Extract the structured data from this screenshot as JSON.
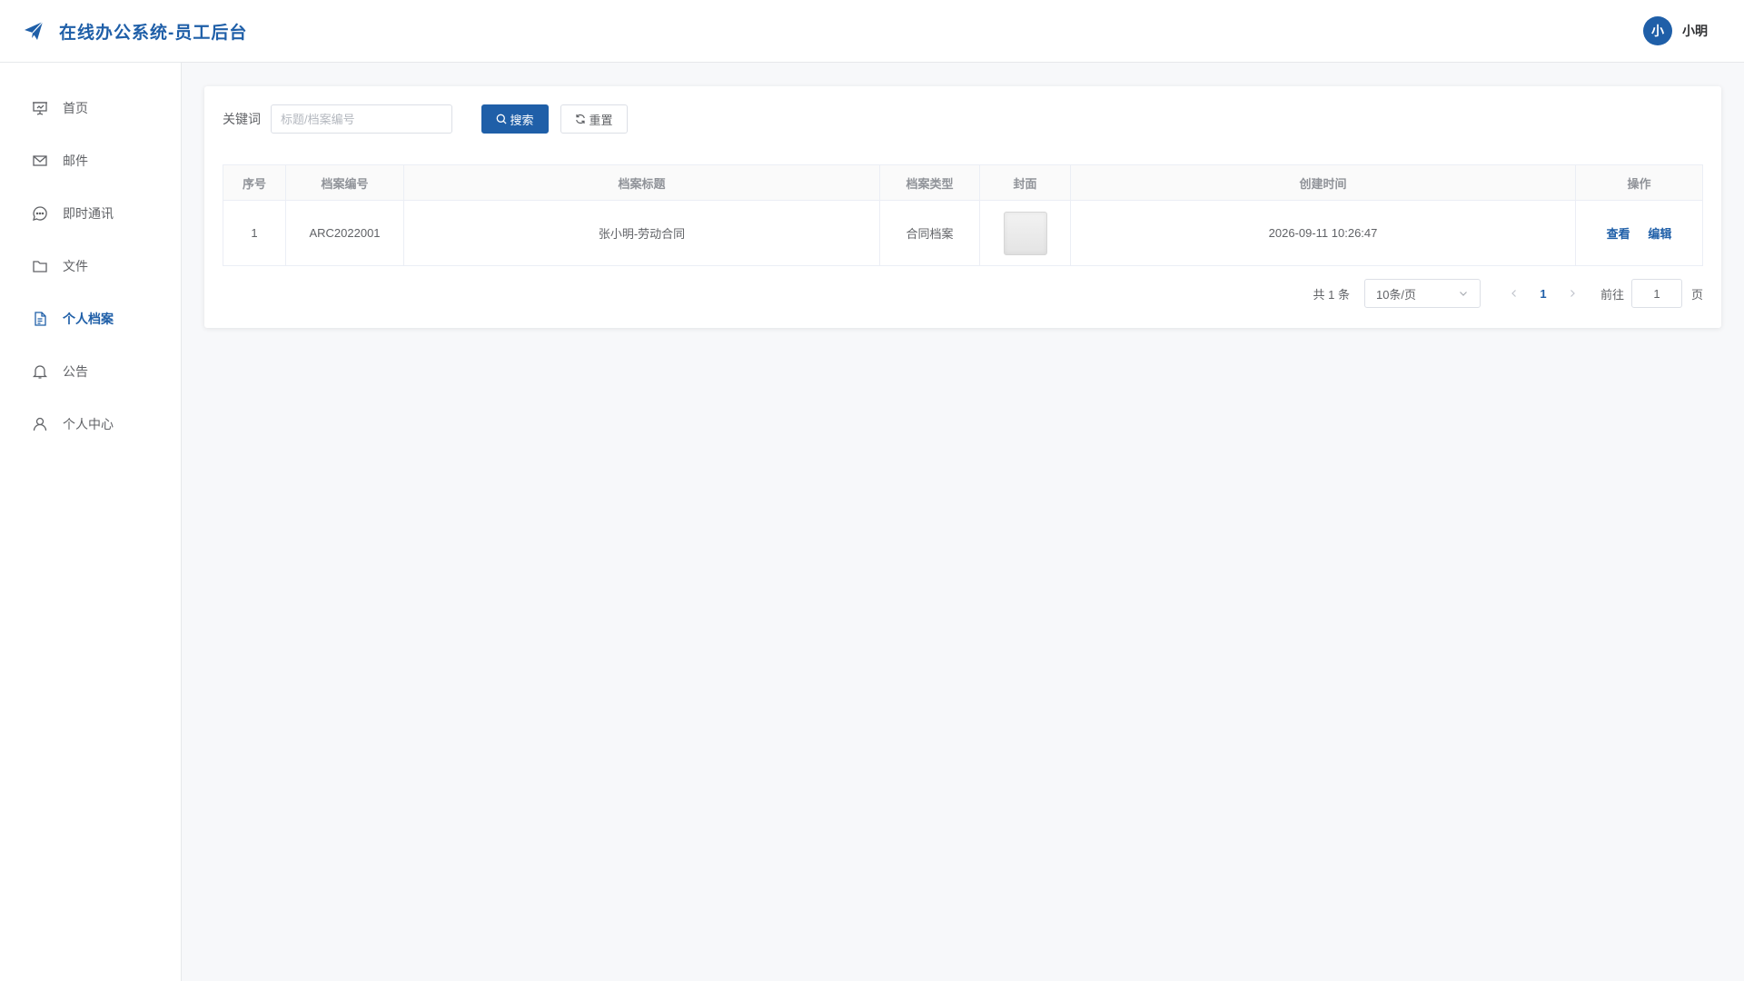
{
  "app": {
    "title": "在线办公系统-员工后台"
  },
  "user": {
    "avatar_text": "小",
    "name": "小明"
  },
  "sidebar": {
    "items": [
      {
        "label": "首页",
        "icon": "presentation-icon"
      },
      {
        "label": "邮件",
        "icon": "mail-icon"
      },
      {
        "label": "即时通讯",
        "icon": "chat-icon"
      },
      {
        "label": "文件",
        "icon": "folder-icon"
      },
      {
        "label": "个人档案",
        "icon": "document-icon",
        "active": true
      },
      {
        "label": "公告",
        "icon": "bell-icon"
      },
      {
        "label": "个人中心",
        "icon": "user-icon"
      }
    ]
  },
  "filter": {
    "label": "关键词",
    "placeholder": "标题/档案编号",
    "value": "",
    "search_label": "搜索",
    "reset_label": "重置"
  },
  "table": {
    "headers": [
      "序号",
      "档案编号",
      "档案标题",
      "档案类型",
      "封面",
      "创建时间",
      "操作"
    ],
    "rows": [
      {
        "index": "1",
        "code": "ARC2022001",
        "title": "张小明-劳动合同",
        "type": "合同档案",
        "created": "2026-09-11 10:26:47",
        "view_label": "查看",
        "edit_label": "编辑"
      }
    ]
  },
  "pagination": {
    "total_text": "共 1 条",
    "page_size": "10条/页",
    "current_page": "1",
    "goto_label": "前往",
    "goto_value": "1",
    "page_unit": "页"
  },
  "colors": {
    "accent": "#1f5fa8",
    "background": "#f7f8fa"
  }
}
